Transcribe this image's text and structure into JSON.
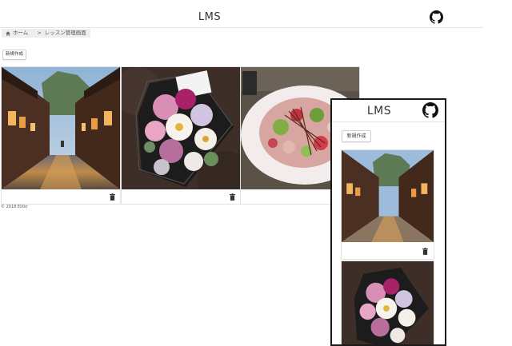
{
  "header": {
    "title": "LMS",
    "github_icon": "github-icon"
  },
  "breadcrumb": {
    "home_icon": "home-icon",
    "home": "ホーム",
    "separator": ">",
    "current": "レッスン管理画面"
  },
  "actions": {
    "new_label": "新規作成"
  },
  "cards": [
    {
      "image": "street-photo",
      "delete_icon": "trash-icon"
    },
    {
      "image": "flower-box-photo",
      "delete_icon": "trash-icon"
    },
    {
      "image": "salad-photo"
    }
  ],
  "footer": {
    "copyright": "© 2018 EIXkr"
  },
  "mobile_preview": {
    "title": "LMS",
    "new_label": "新規作成"
  }
}
